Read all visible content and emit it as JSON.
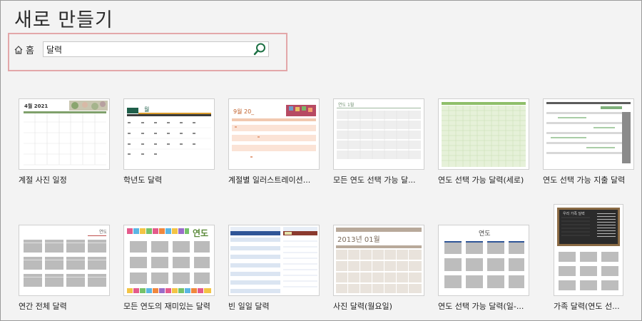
{
  "header": {
    "title": "새로 만들기"
  },
  "search": {
    "home_label": "홈",
    "value": "달력"
  },
  "row1": [
    {
      "label": "계절 사진 일정",
      "thumb_title": "4월 2021"
    },
    {
      "label": "학년도 달력",
      "thumb_title": "월"
    },
    {
      "label": "계절별 일러스트레이션...",
      "thumb_title": "9월 20_"
    },
    {
      "label": "모든 연도 선택 가능 달...",
      "thumb_title": "연도 1월"
    },
    {
      "label": "연도 선택 가능 달력(세로)",
      "thumb_title": ""
    },
    {
      "label": "연도 선택 가능 지출 달력",
      "thumb_title": ""
    }
  ],
  "row2": [
    {
      "label": "연간 전체 달력",
      "thumb_title": "연도"
    },
    {
      "label": "모든 연도의 재미있는 달력",
      "thumb_title": "연도"
    },
    {
      "label": "빈 일일 달력",
      "thumb_title": "일일 달력"
    },
    {
      "label": "사진 달력(월요일)",
      "thumb_title": "2013년 01월"
    },
    {
      "label": "연도 선택 가능 달력(일-...",
      "thumb_title": "연도"
    },
    {
      "label": "가족 달력(연도 선...",
      "thumb_title": "우리 가족 달력"
    }
  ],
  "colors": {
    "highlight_border": "#e3a7a9",
    "accent_green": "#2e7d32"
  }
}
